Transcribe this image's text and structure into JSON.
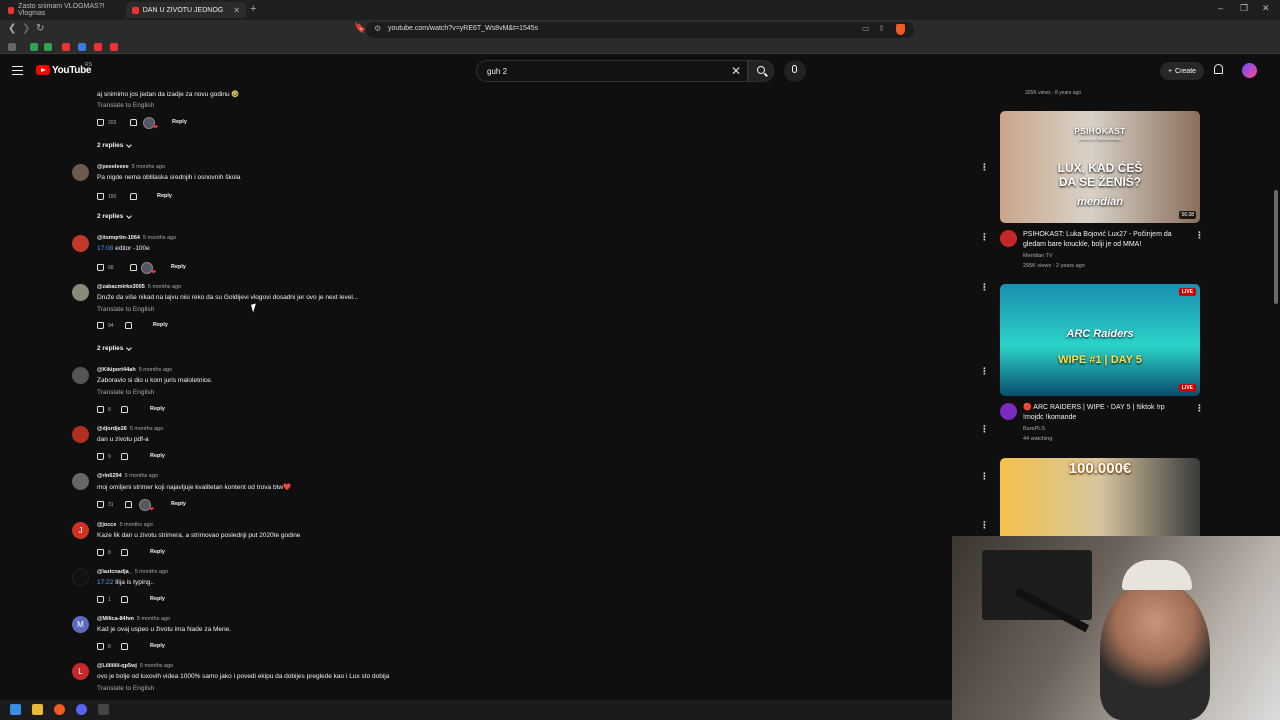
{
  "browser": {
    "tabs": [
      {
        "label": "Zasto snimam VLOGMAS?! Vlogmas"
      },
      {
        "label": "DAN U ZIVOTU JEDNOG STRIMERA"
      }
    ],
    "url": "youtube.com/watch?v=yRE6T_Ws8vM&t=1545s"
  },
  "header": {
    "logo": "YouTube",
    "country": "RS",
    "search_value": "guh 2",
    "create_label": "Create"
  },
  "comments": {
    "top_text": "aj snimimo jos jedan da izadje za novu godinu 🤣",
    "translate_label": "Translate to English",
    "reply_label": "Reply",
    "replies_label": "2 replies",
    "top_likes": "203",
    "items": [
      {
        "author": "@peeeleeee",
        "time": "5 months ago",
        "text": "Pa nigde nema oblilaska srednjih i osnovnih škola",
        "likes": "150"
      },
      {
        "author": "@itsmqrtin-1064",
        "time": "5 months ago",
        "ts": "17:08",
        "text": " editor -100e",
        "likes": "68"
      },
      {
        "author": "@zabacmirko3005",
        "time": "5 months ago",
        "text": "Druže da više nikad na lajvu nisi reko da su Goldijevi vlogovi dosadni jer ovo je next level...",
        "likes": "94"
      },
      {
        "author": "@Kikiport44ah",
        "time": "5 months ago",
        "text": "Zaboravio si dio u kom juris maloletnice.",
        "likes": "8"
      },
      {
        "author": "@djordje26",
        "time": "5 months ago",
        "text": "dan u zivotu pdf-a",
        "likes": "9"
      },
      {
        "author": "@rin6294",
        "time": "5 months ago",
        "text": "moj omiljeni strimer koji najavljuje kvalitetan kontent od trova btw❤️",
        "likes": "31"
      },
      {
        "author": "@jocce",
        "time": "5 months ago",
        "text": "Kaze lik dan u zivotu strimera, a strimovao poslednji put 2020te godine",
        "likes": "8",
        "initial": "J"
      },
      {
        "author": "@lazicnadja_",
        "time": "5 months ago",
        "ts": "17:22",
        "text": " Ilija is typing..",
        "likes": "1"
      },
      {
        "author": "@Milica-84hm",
        "time": "5 months ago",
        "text": "Kad je ovaj uspeo u životu ima Nade za Mene.",
        "likes": "8",
        "initial": "M"
      },
      {
        "author": "@Lilililili-qp5wj",
        "time": "5 months ago",
        "text": "ovo je bolje od luxovih videa 1000% samo jako i povedi ekipu da dobijes preglede kao i Lux sto dobija",
        "initial": "L"
      }
    ]
  },
  "sidebar": {
    "top_meta": "325K views · 8 years ago",
    "videos": [
      {
        "thumb_title": "LUX, KAD ĆEŠ DA SE ŽENIŠ?",
        "thumb_brand": "PSIHOKAST",
        "thumb_brand_sub": "podcast by Nikola Bokonjić",
        "thumb_sub": "meridian",
        "duration": "56:38",
        "title": "PSIHOKAST: Luka Bojović Lux27 - Počinjem da gledam bare knuckle, bolji je od MMA!",
        "channel": "Meridian TV",
        "meta": "295K views · 2 years ago"
      },
      {
        "thumb_title": "WIPE #1 | DAY 5",
        "thumb_logo": "ARC Raiders",
        "live_top": "LIVE",
        "live_bottom": "LIVE",
        "title": "🔴 ARC RAIDERS | WIPE - DAY 5 | !tiktok !rp !mojdc !komande",
        "channel": "BarePLS",
        "meta": "44 watching"
      },
      {
        "thumb_title": "100.000€"
      }
    ]
  },
  "colors": {
    "background": "#0f0f0f",
    "youtube_red": "#ff0000",
    "link_blue": "#3ea6ff"
  }
}
